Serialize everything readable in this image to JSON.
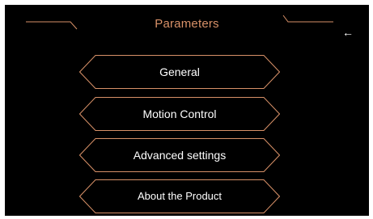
{
  "header": {
    "title": "Parameters",
    "back_icon": "←"
  },
  "menu": {
    "items": [
      {
        "label": "General"
      },
      {
        "label": "Motion Control"
      },
      {
        "label": "Advanced settings"
      },
      {
        "label": "About the Product"
      }
    ]
  },
  "colors": {
    "accent": "#d89168",
    "background": "#000000",
    "text": "#ffffff"
  }
}
